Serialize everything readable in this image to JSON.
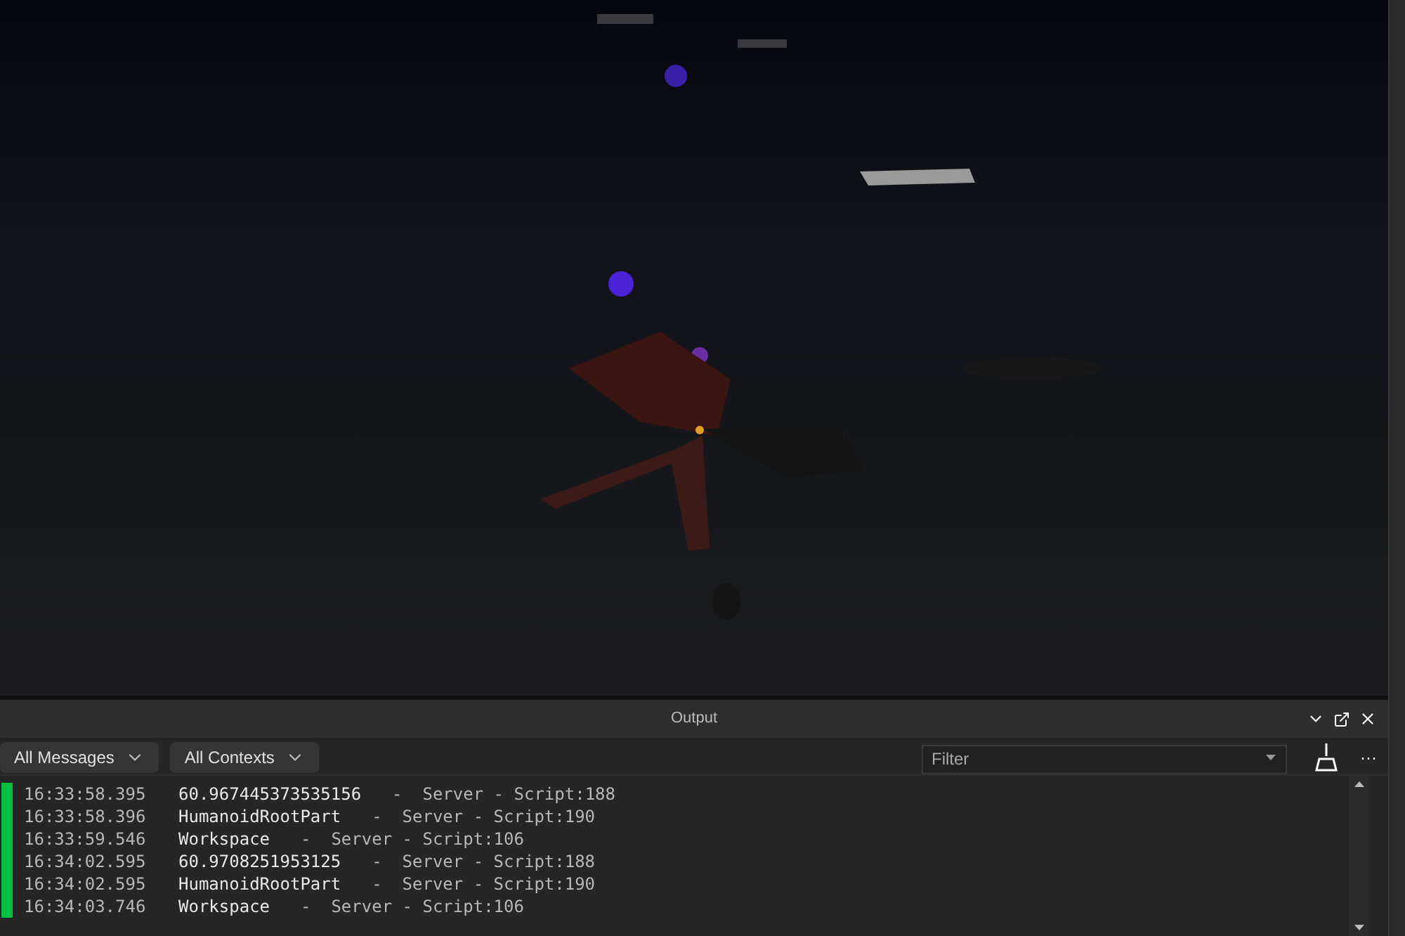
{
  "output": {
    "title": "Output",
    "message_filter": {
      "label": "All Messages"
    },
    "context_filter": {
      "label": "All Contexts"
    },
    "filter_field": {
      "placeholder": "Filter"
    },
    "more_label": "···",
    "messages": [
      {
        "time": "16:33:58.395",
        "text": "60.967445373535156",
        "source": "-  Server - Script:188"
      },
      {
        "time": "16:33:58.396",
        "text": "HumanoidRootPart",
        "source": "-  Server - Script:190"
      },
      {
        "time": "16:33:59.546",
        "text": "Workspace",
        "source": "-  Server - Script:106"
      },
      {
        "time": "16:34:02.595",
        "text": "60.9708251953125",
        "source": "-  Server - Script:188"
      },
      {
        "time": "16:34:02.595",
        "text": "HumanoidRootPart",
        "source": "-  Server - Script:190"
      },
      {
        "time": "16:34:03.746",
        "text": "Workspace",
        "source": "-  Server - Script:106"
      }
    ]
  }
}
